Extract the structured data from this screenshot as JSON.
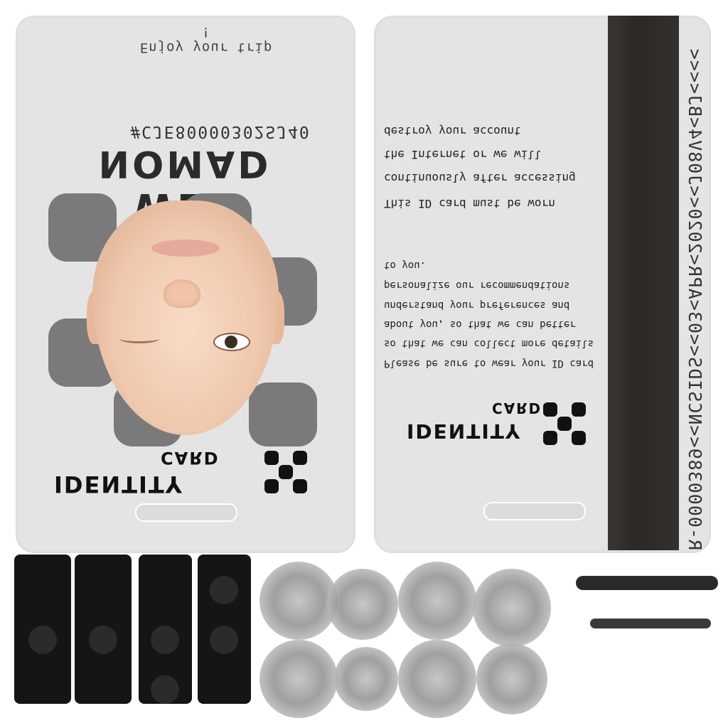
{
  "front": {
    "tagline": "Enjoy your trip !",
    "serial": "#CJE80000302SJ40",
    "title": "WEB NOMAD",
    "card_label": "CARD",
    "identity_label": "IDENTITY"
  },
  "back": {
    "card_label": "CARD",
    "identity_label": "IDENTITY",
    "notice_lines": [
      "This ID card must be worn",
      "continuously after accessing",
      "the Internet or we will",
      "destroy your account"
    ],
    "detail_lines": [
      "Please be sure to wear your ID card",
      "so that we can collect more details",
      "about you, so that we can better",
      "understand your preferences and",
      "personalize our recommendations",
      "to you."
    ],
    "mrz": "R-0000389<<NCSIDS<<03<APR<2020<<J08V4<BJ<<<<"
  },
  "colors": {
    "card_bg": "#e4e4e4",
    "pattern": "#7a7a7a",
    "stripe": "#2b2826",
    "logo": "#111111"
  }
}
